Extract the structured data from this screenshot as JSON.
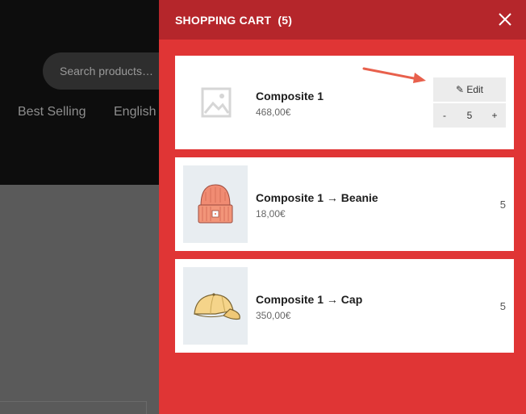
{
  "background": {
    "search_placeholder": "Search products…",
    "nav": [
      "Best Selling",
      "English"
    ]
  },
  "cart": {
    "title": "SHOPPING CART",
    "count": "(5)",
    "items": [
      {
        "name": "Composite 1",
        "price": "468,00€",
        "image": "placeholder-image-icon",
        "edit_label": "✎ Edit",
        "stepper": {
          "minus": "-",
          "value": "5",
          "plus": "+"
        }
      },
      {
        "name": "Composite 1 → Beanie",
        "price": "18,00€",
        "image": "beanie-image",
        "qty": "5"
      },
      {
        "name": "Composite 1 → Cap",
        "price": "350,00€",
        "image": "cap-image",
        "qty": "5"
      }
    ]
  },
  "colors": {
    "drawer": "#e03535",
    "drawer_header": "#b5262b",
    "arrow": "#e8604c"
  }
}
